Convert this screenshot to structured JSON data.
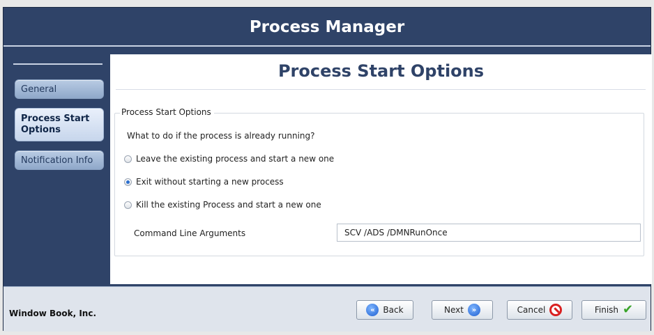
{
  "window": {
    "title": "Process Manager"
  },
  "sidebar": {
    "items": [
      {
        "label": "General"
      },
      {
        "label": "Process Start Options"
      },
      {
        "label": "Notification Info"
      }
    ]
  },
  "content": {
    "title": "Process Start Options",
    "group_label": "Process Start Options",
    "question": "What to do if the process is already running?",
    "options": [
      {
        "label": "Leave the existing process and start a new one",
        "checked": false
      },
      {
        "label": "Exit without starting a new process",
        "checked": true
      },
      {
        "label": "Kill the existing Process and start a new one",
        "checked": false
      }
    ],
    "cmd_label": "Command Line Arguments",
    "cmd_value": "SCV /ADS /DMNRunOnce"
  },
  "footer": {
    "company": "Window Book, Inc.",
    "back_label": "Back",
    "next_label": "Next",
    "cancel_label": "Cancel",
    "finish_label": "Finish"
  },
  "colors": {
    "window_bg": "#2f4368",
    "accent_text": "#2f4368",
    "selected_radio": "#2b6fcf",
    "cancel_icon": "#d92020",
    "finish_icon": "#3aa42a"
  }
}
